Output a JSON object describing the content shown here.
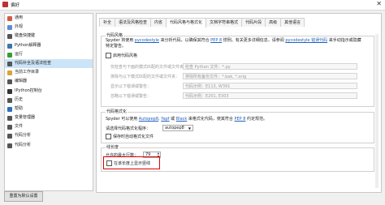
{
  "window": {
    "title": "偏好",
    "close_glyph": "✕"
  },
  "sidebar": {
    "items": [
      {
        "label": "通用",
        "color": "#d25b43"
      },
      {
        "label": "外观",
        "color": "#5c8bd6"
      },
      {
        "label": "键盘快捷键",
        "color": "#555555"
      },
      {
        "label": "Python解释器",
        "color": "#3b77a8"
      },
      {
        "label": "运行",
        "color": "#3a9a3a"
      },
      {
        "label": "代码补全及语法检查",
        "color": "#555555",
        "selected": true
      },
      {
        "label": "当前工作目录",
        "color": "#d9a23a"
      },
      {
        "label": "编辑器",
        "color": "#555555"
      },
      {
        "label": "IPython控制台",
        "color": "#333333"
      },
      {
        "label": "历史",
        "color": "#555555"
      },
      {
        "label": "帮助",
        "color": "#2d6fb5"
      },
      {
        "label": "变量管理器",
        "color": "#555555"
      },
      {
        "label": "文件",
        "color": "#555555"
      },
      {
        "label": "代码分析",
        "color": "#555555"
      },
      {
        "label": "代码分析",
        "color": "#555555"
      }
    ],
    "selected_bg": "#cce4f7"
  },
  "reset_button": "重置为默认设置",
  "tabs": [
    {
      "label": "补全"
    },
    {
      "label": "语法及风格检查"
    },
    {
      "label": "内省"
    },
    {
      "label": "代码风格与格式化",
      "active": true
    },
    {
      "label": "文档字符串格式"
    },
    {
      "label": "代码片段"
    },
    {
      "label": "高级"
    },
    {
      "label": "其他语言"
    }
  ],
  "code_style": {
    "title": "代码风格",
    "desc_pre": "Spyder 将使用 ",
    "desc_link1": "pycodestyle",
    "desc_mid": " 来分析代码，以确保其符合 ",
    "desc_link2": "PEP 8",
    "desc_mid2": " 惯例。有关更多详细信息，请参阅 ",
    "desc_link3": "pycodestyle 错误代码",
    "desc_post": " 来手动指示或隐藏特定警告。",
    "enable_label": "启用代码风格",
    "rows": [
      {
        "label": "仅检查与下面的模式匹配的文件或文件夹：",
        "placeholder": "检查 Python 文件：*.py"
      },
      {
        "label": "排除与以下模式匹配的文件或文件夹：",
        "placeholder": "排除所有备份文件：*.bak, *.orig"
      },
      {
        "label": "显示以下错误或警告：",
        "placeholder": "代码示例：E113, W391"
      },
      {
        "label": "忽略以下错误或警告：",
        "placeholder": "代码示例：E201, E303"
      }
    ]
  },
  "formatting": {
    "title": "代码格式化",
    "desc_pre": "Spyder 可以使用 ",
    "desc_link1": "Autopep8",
    "desc_sep1": ", ",
    "desc_link2": "Yapf",
    "desc_sep2": " 或 ",
    "desc_link3": "Black",
    "desc_mid": " 来格式化代码，使其符合 ",
    "desc_link4": "PEP 8",
    "desc_post": " 约定规范。",
    "select_label": "请选择代码格式化程序：",
    "select_value": "autopep8",
    "autosave_label": "保存时自动格式化文件"
  },
  "line_length": {
    "title": "线长度",
    "max_label": "允许的最大行数：",
    "max_value": "79",
    "show_label": "在该长度上显示竖线"
  },
  "colors": {
    "link": "#1f5fbf",
    "highlight_box": "#e00000"
  }
}
